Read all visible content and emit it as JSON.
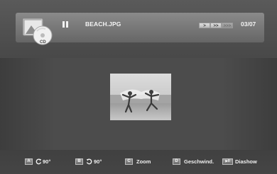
{
  "header": {
    "filename": "BEACH.JPG",
    "counter": "03/07",
    "speed_buttons": [
      ">",
      ">>",
      ">>>"
    ],
    "cd_label": "CD"
  },
  "footer": {
    "items": [
      {
        "key": "A",
        "label": "90°",
        "icon": "rotate-left-icon"
      },
      {
        "key": "B",
        "label": "90°",
        "icon": "rotate-right-icon"
      },
      {
        "key": "C",
        "label": "Zoom"
      },
      {
        "key": "D",
        "label": "Geschwind."
      },
      {
        "key": "▶II",
        "label": "Diashow"
      }
    ]
  },
  "colors": {
    "header": "#777777",
    "background": "#4a4a4a",
    "text": "#f4f4f4"
  }
}
